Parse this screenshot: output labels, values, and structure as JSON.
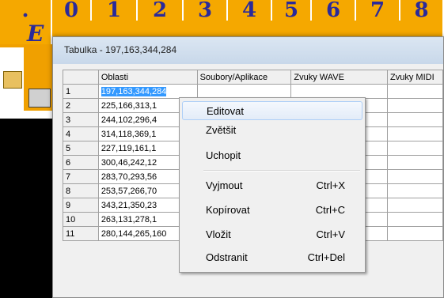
{
  "background_toolbar": {
    "row1": [
      ".",
      "0",
      "1",
      "2",
      "3",
      "4",
      "5",
      "6",
      "7",
      "8"
    ],
    "e_label": "E"
  },
  "window": {
    "title": "Tabulka - 197,163,344,284"
  },
  "table": {
    "columns": [
      "",
      "Oblasti",
      "Soubory/Aplikace",
      "Zvuky WAVE",
      "Zvuky MIDI"
    ],
    "rows": [
      {
        "num": "1",
        "oblasti": "197,163,344,284"
      },
      {
        "num": "2",
        "oblasti": "225,166,313,1"
      },
      {
        "num": "3",
        "oblasti": "244,102,296,4"
      },
      {
        "num": "4",
        "oblasti": "314,118,369,1"
      },
      {
        "num": "5",
        "oblasti": "227,119,161,1"
      },
      {
        "num": "6",
        "oblasti": "300,46,242,12"
      },
      {
        "num": "7",
        "oblasti": "283,70,293,56"
      },
      {
        "num": "8",
        "oblasti": "253,57,266,70"
      },
      {
        "num": "9",
        "oblasti": "343,21,350,23"
      },
      {
        "num": "10",
        "oblasti": "263,131,278,1"
      },
      {
        "num": "11",
        "oblasti": "280,144,265,160"
      }
    ]
  },
  "context_menu": {
    "items": [
      {
        "label": "Editovat",
        "shortcut": ""
      },
      {
        "label": "Zvětšit",
        "shortcut": ""
      },
      {
        "label": "Uchopit",
        "shortcut": ""
      },
      {
        "label": "Vyjmout",
        "shortcut": "Ctrl+X"
      },
      {
        "label": "Kopírovat",
        "shortcut": "Ctrl+C"
      },
      {
        "label": "Vložit",
        "shortcut": "Ctrl+V"
      },
      {
        "label": "Odstranit",
        "shortcut": "Ctrl+Del"
      }
    ]
  },
  "colors": {
    "toolbar_orange": "#f5a800",
    "toolbar_text": "#2a2a9a",
    "selection": "#3399ff"
  }
}
